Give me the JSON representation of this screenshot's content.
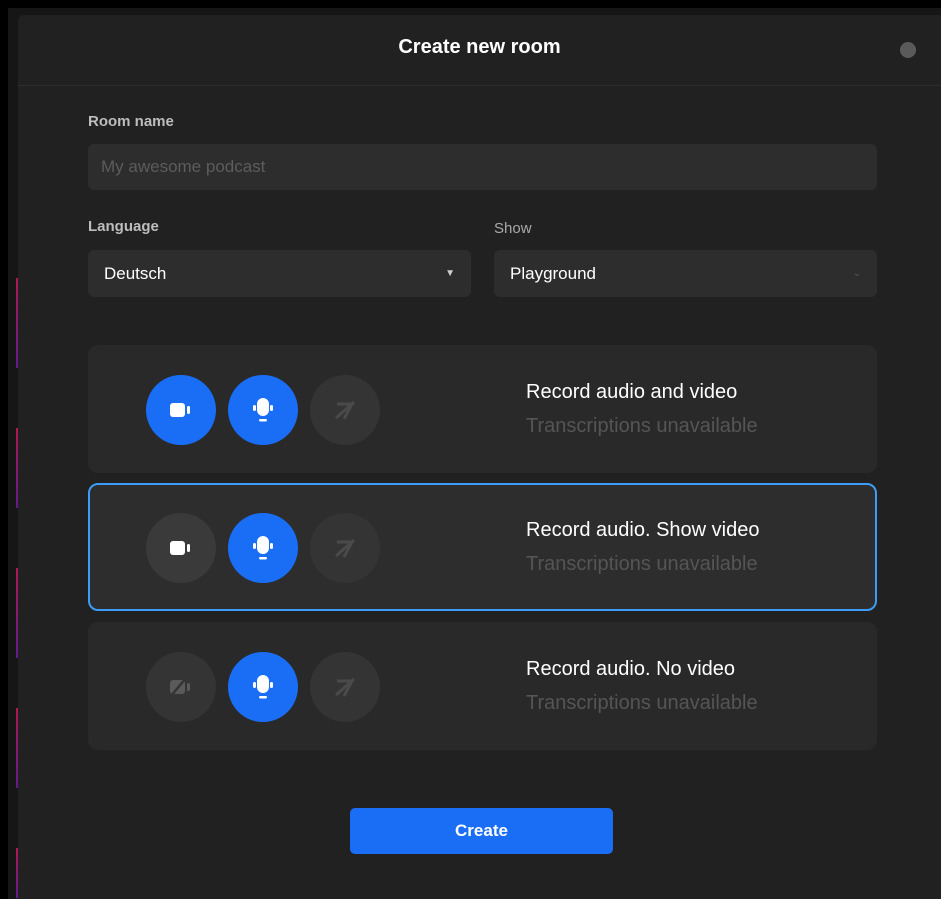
{
  "dialog": {
    "title": "Create new room"
  },
  "room_name": {
    "label": "Room name",
    "placeholder": "My awesome podcast",
    "value": ""
  },
  "language": {
    "label": "Language",
    "selected": "Deutsch"
  },
  "show": {
    "label": "Show",
    "selected": "Playground"
  },
  "modes": [
    {
      "title": "Record audio and video",
      "subtitle": "Transcriptions unavailable",
      "selected": false,
      "icons": [
        "video-camera-icon",
        "microphone-icon",
        "transcription-off-icon"
      ]
    },
    {
      "title": "Record audio. Show video",
      "subtitle": "Transcriptions unavailable",
      "selected": true,
      "icons": [
        "video-camera-icon",
        "microphone-icon",
        "transcription-off-icon"
      ]
    },
    {
      "title": "Record audio. No video",
      "subtitle": "Transcriptions unavailable",
      "selected": false,
      "icons": [
        "video-camera-off-icon",
        "microphone-icon",
        "transcription-off-icon"
      ]
    }
  ],
  "create_button": {
    "label": "Create"
  },
  "colors": {
    "accent": "#1a6ef5",
    "selected_border": "#3d9cf5",
    "background": "#212121"
  }
}
